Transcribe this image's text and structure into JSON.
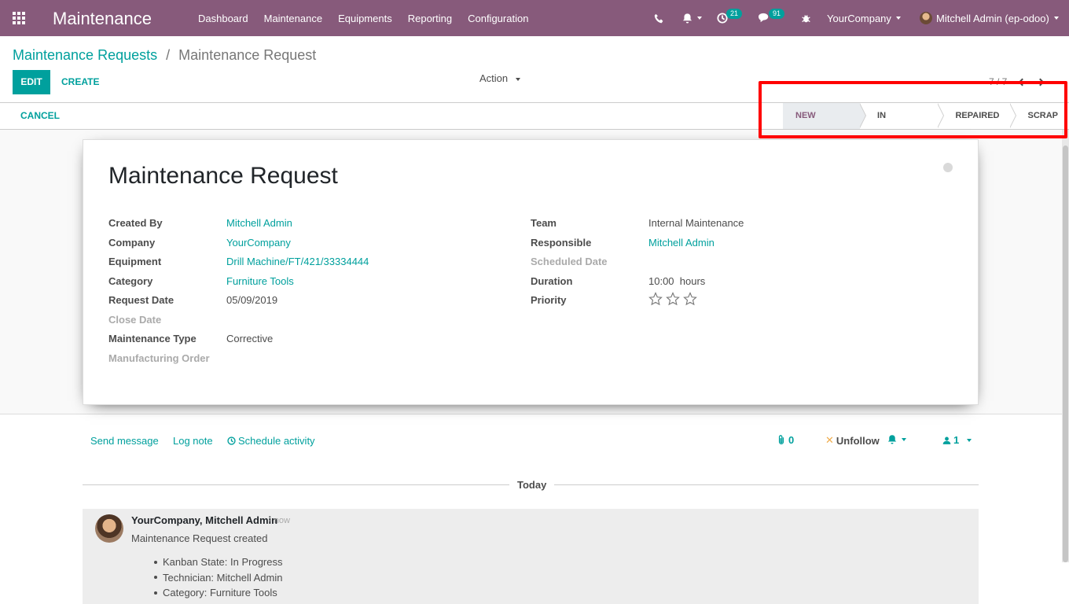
{
  "navbar": {
    "brand": "Maintenance",
    "menu": [
      "Dashboard",
      "Maintenance",
      "Equipments",
      "Reporting",
      "Configuration"
    ],
    "activity_count": "21",
    "messages_count": "91",
    "company": "YourCompany",
    "user": "Mitchell Admin (ep-odoo)"
  },
  "breadcrumb": {
    "parent": "Maintenance Requests",
    "separator": "/",
    "current": "Maintenance Request"
  },
  "buttons": {
    "edit": "EDIT",
    "create": "CREATE",
    "action": "Action",
    "cancel": "CANCEL"
  },
  "pager": {
    "value": "7 / 7"
  },
  "stages": [
    {
      "label": "NEW REQUEST",
      "active": true
    },
    {
      "label": "IN PROGRESS",
      "active": false
    },
    {
      "label": "REPAIRED",
      "active": false
    },
    {
      "label": "SCRAP",
      "active": false
    }
  ],
  "form": {
    "title": "Maintenance Request",
    "left": [
      {
        "label": "Created By",
        "value": "Mitchell Admin",
        "link": true,
        "muted": false
      },
      {
        "label": "Company",
        "value": "YourCompany",
        "link": true,
        "muted": false
      },
      {
        "label": "Equipment",
        "value": "Drill Machine/FT/421/33334444",
        "link": true,
        "muted": false
      },
      {
        "label": "Category",
        "value": "Furniture Tools",
        "link": true,
        "muted": false
      },
      {
        "label": "Request Date",
        "value": "05/09/2019",
        "link": false,
        "muted": false
      },
      {
        "label": "Close Date",
        "value": "",
        "link": false,
        "muted": true
      },
      {
        "label": "Maintenance Type",
        "value": "Corrective",
        "link": false,
        "muted": false
      },
      {
        "label": "Manufacturing Order",
        "value": "",
        "link": false,
        "muted": true
      }
    ],
    "right": [
      {
        "label": "Team",
        "value": "Internal Maintenance",
        "link": false,
        "muted": false
      },
      {
        "label": "Responsible",
        "value": "Mitchell Admin",
        "link": true,
        "muted": false
      },
      {
        "label": "Scheduled Date",
        "value": "",
        "link": false,
        "muted": true
      },
      {
        "label": "Duration",
        "value": "10:00  hours",
        "link": false,
        "muted": false
      },
      {
        "label": "Priority",
        "value": "",
        "link": false,
        "muted": false
      }
    ],
    "priority_stars": 0,
    "priority_max": 3
  },
  "chatter": {
    "send_message": "Send message",
    "log_note": "Log note",
    "schedule_activity": "Schedule activity",
    "attachments": "0",
    "unfollow": "Unfollow",
    "followers": "1",
    "date_separator": "Today",
    "message": {
      "author": "YourCompany, Mitchell Admin",
      "time": "- now",
      "body": "Maintenance Request created",
      "tracking": [
        "Kanban State: In Progress",
        "Technician: Mitchell Admin",
        "Category: Furniture Tools"
      ]
    }
  },
  "colors": {
    "navbar": "#875a7b",
    "primary": "#00a09d",
    "highlight": "#ff0000"
  }
}
